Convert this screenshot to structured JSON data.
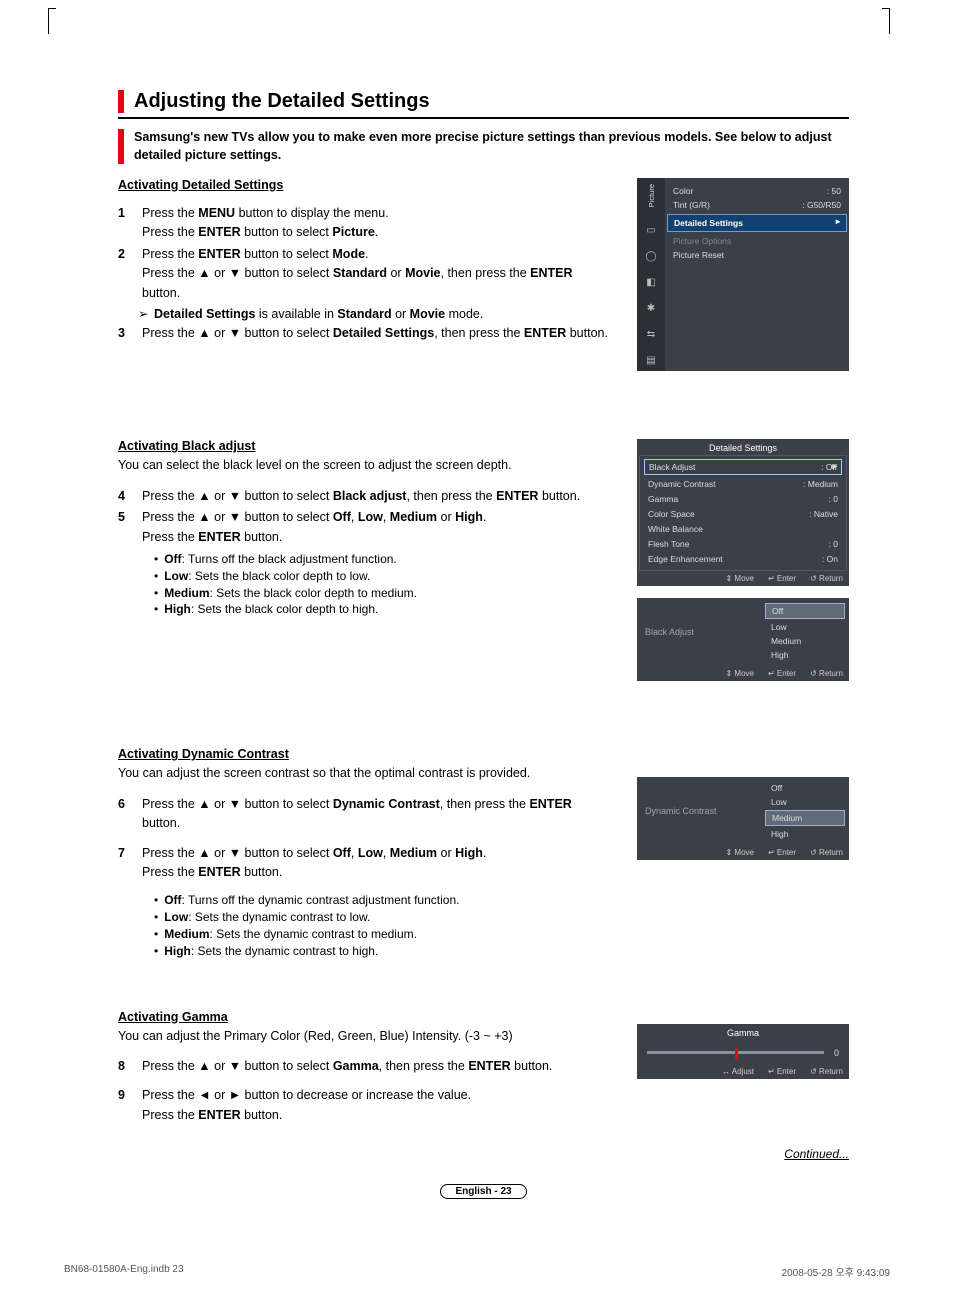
{
  "title": "Adjusting the Detailed Settings",
  "intro": "Samsung's new TVs allow you to make even more precise picture settings than previous models. See below to adjust detailed picture settings.",
  "sub1": "Activating Detailed Settings",
  "s1a": "Press the ",
  "s1b": "MENU",
  "s1c": " button to display the menu.",
  "s1d": "Press the ",
  "s1e": "ENTER",
  "s1f": " button to select ",
  "s1g": "Picture",
  "s1h": ".",
  "s2a": "Press the ",
  "s2b": "ENTER",
  "s2c": " button to select ",
  "s2d": "Mode",
  "s2e": ".",
  "s2f": "Press the ▲ or ▼ button to select ",
  "s2g": "Standard",
  "s2h": " or ",
  "s2i": "Movie",
  "s2j": ", then press the ",
  "s2k": "ENTER",
  "s2l": " button.",
  "note1a": "Detailed Settings",
  "note1b": " is available in ",
  "note1c": "Standard",
  "note1d": " or ",
  "note1e": "Movie",
  "note1f": " mode.",
  "s3a": "Press the ▲ or ▼ button to select ",
  "s3b": "Detailed Settings",
  "s3c": ", then press the ",
  "s3d": "ENTER",
  "s3e": " button.",
  "sub2": "Activating Black adjust",
  "body2": "You can select the black level on the screen to adjust the screen depth.",
  "s4a": "Press the ▲ or ▼ button to select ",
  "s4b": "Black adjust",
  "s4c": ", then press the ",
  "s4d": "ENTER",
  "s4e": " button.",
  "s5a": "Press the ▲ or ▼ button to select ",
  "s5b": "Off",
  "s5c": ", ",
  "s5d": "Low",
  "s5e": ", ",
  "s5f": "Medium",
  "s5g": " or ",
  "s5h": "High",
  "s5i": ".",
  "s5j": "Press the ",
  "s5k": "ENTER",
  "s5l": " button.",
  "b1a": "Off",
  "b1b": ": Turns off the black adjustment function.",
  "b2a": "Low",
  "b2b": ": Sets the black color depth to low.",
  "b3a": "Medium",
  "b3b": ": Sets the black color depth to medium.",
  "b4a": "High",
  "b4b": ": Sets the black color depth to high.",
  "sub3": "Activating Dynamic Contrast",
  "body3": "You can adjust the screen contrast so that the optimal contrast is provided.",
  "s6a": "Press the ▲ or ▼ button to select ",
  "s6b": "Dynamic Contrast",
  "s6c": ", then press the ",
  "s6d": "ENTER",
  "s6e": " button.",
  "s7a": "Press the ▲ or ▼ button to select ",
  "s7b": "Off",
  "s7c": ", ",
  "s7d": "Low",
  "s7e": ", ",
  "s7f": "Medium",
  "s7g": " or ",
  "s7h": "High",
  "s7i": ".",
  "s7j": "Press the ",
  "s7k": "ENTER",
  "s7l": " button.",
  "c1a": "Off",
  "c1b": ": Turns off the dynamic contrast adjustment function.",
  "c2a": "Low",
  "c2b": ": Sets the dynamic contrast to low.",
  "c3a": "Medium",
  "c3b": ": Sets the dynamic contrast to medium.",
  "c4a": "High",
  "c4b": ": Sets the dynamic contrast to high.",
  "sub4": "Activating Gamma",
  "body4": "You can adjust the Primary Color (Red, Green, Blue) Intensity. (-3 ~ +3)",
  "s8a": "Press the ▲ or ▼ button to select ",
  "s8b": "Gamma",
  "s8c": ", then press the ",
  "s8d": "ENTER",
  "s8e": " button.",
  "s9a": "Press the ◄ or ► button to decrease or increase the value.",
  "s9b": "Press the ",
  "s9c": "ENTER",
  "s9d": " button.",
  "continued": "Continued...",
  "pager": "English - 23",
  "foot_left": "BN68-01580A-Eng.indb   23",
  "foot_right": "2008-05-28   오후 9:43:09",
  "pm": {
    "sideLabel": "Picture",
    "color": "Color",
    "colorV": ": 50",
    "tint": "Tint (G/R)",
    "tintV": ": G50/R50",
    "ds": "Detailed Settings",
    "po": "Picture Options",
    "pr": "Picture Reset"
  },
  "ds": {
    "title": "Detailed Settings",
    "r1": "Black Adjust",
    "r1v": ": Off",
    "r2": "Dynamic Contrast",
    "r2v": ": Medium",
    "r3": "Gamma",
    "r3v": ": 0",
    "r4": "Color Space",
    "r4v": ": Native",
    "r5": "White Balance",
    "r6": "Flesh Tone",
    "r6v": ": 0",
    "r7": "Edge Enhancement",
    "r7v": ": On"
  },
  "foot": {
    "move": "Move",
    "enter": "Enter",
    "return": "Return",
    "adjust": "Adjust"
  },
  "opt": {
    "off": "Off",
    "low": "Low",
    "medium": "Medium",
    "high": "High"
  },
  "ba": "Black Adjust",
  "dc": "Dynamic Contrast",
  "gm": "Gamma",
  "gmv": "0",
  "icons": {
    "updown": "⇕",
    "enter": "↵",
    "return": "↺",
    "leftright": "↔"
  }
}
